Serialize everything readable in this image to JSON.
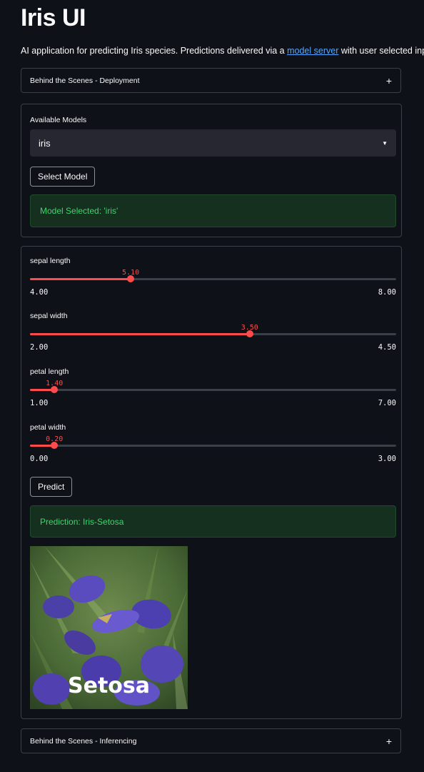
{
  "app": {
    "title": "Iris UI",
    "intro_before": "AI application for predicting Iris species. Predictions delivered via a ",
    "intro_link": "model server",
    "intro_after": " with user selected input."
  },
  "expanders": {
    "deployment": "Behind the Scenes - Deployment",
    "inferencing": "Behind the Scenes - Inferencing",
    "toggle_icon": "+"
  },
  "models": {
    "label": "Available Models",
    "selected": "iris",
    "select_button": "Select Model",
    "status": "Model Selected: 'iris'"
  },
  "sliders": [
    {
      "label": "sepal length",
      "value": "5.10",
      "min": "4.00",
      "max": "8.00",
      "fraction": 0.275
    },
    {
      "label": "sepal width",
      "value": "3.50",
      "min": "2.00",
      "max": "4.50",
      "fraction": 0.6
    },
    {
      "label": "petal length",
      "value": "1.40",
      "min": "1.00",
      "max": "7.00",
      "fraction": 0.0667
    },
    {
      "label": "petal width",
      "value": "0.20",
      "min": "0.00",
      "max": "3.00",
      "fraction": 0.0667
    }
  ],
  "predict": {
    "button": "Predict",
    "result": "Prediction: Iris-Setosa",
    "image_caption": "Setosa"
  },
  "colors": {
    "accent": "#ff4b4b",
    "success_text": "#3dd56d",
    "link": "#54a6ff"
  }
}
